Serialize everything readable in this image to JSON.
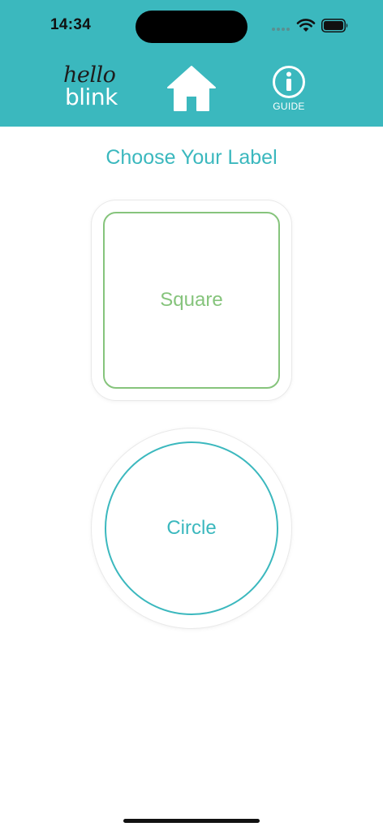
{
  "status_bar": {
    "time": "14:34",
    "icons": [
      "cellular-signal-icon",
      "wifi-icon",
      "battery-icon"
    ]
  },
  "header": {
    "background": "#3bb8be",
    "logo": {
      "line1": "hello",
      "line2": "blink"
    },
    "home": {
      "icon": "home-icon"
    },
    "guide": {
      "icon": "info-icon",
      "label": "GUIDE"
    }
  },
  "main": {
    "title": "Choose Your Label",
    "options": {
      "square": {
        "label": "Square",
        "color": "#86c47c"
      },
      "circle": {
        "label": "Circle",
        "color": "#3bb8be"
      }
    }
  }
}
